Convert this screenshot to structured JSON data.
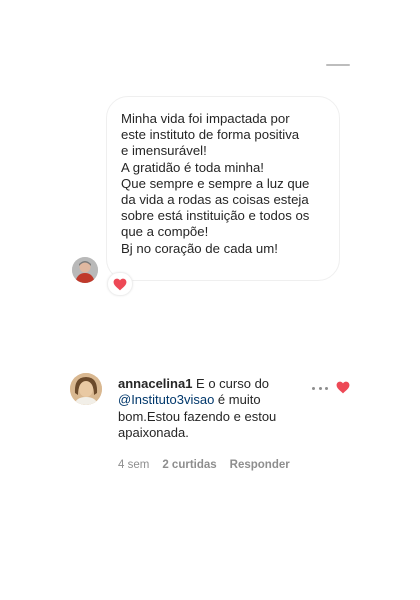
{
  "message": {
    "lines": [
      "Minha vida foi impactada por",
      "este instituto de forma positiva",
      "e imensurável!",
      "A gratidão é toda minha!",
      "Que sempre e sempre a luz que",
      "da vida a rodas as coisas esteja",
      "sobre está instituição e todos os",
      "que a compõe!",
      "Bj no coração de cada um!"
    ],
    "reaction_icon": "heart-icon",
    "reaction_color": "#ed4956"
  },
  "comment": {
    "username": "annacelina1",
    "text_before": " E o curso do ",
    "mention": "@Instituto3visao",
    "text_after": " é muito bom.Estou fazendo e estou apaixonada.",
    "time": "4 sem",
    "likes": "2 curtidas",
    "reply": "Responder",
    "liked": true,
    "like_color": "#ed4956",
    "more_icon": "more-horizontal-icon"
  }
}
